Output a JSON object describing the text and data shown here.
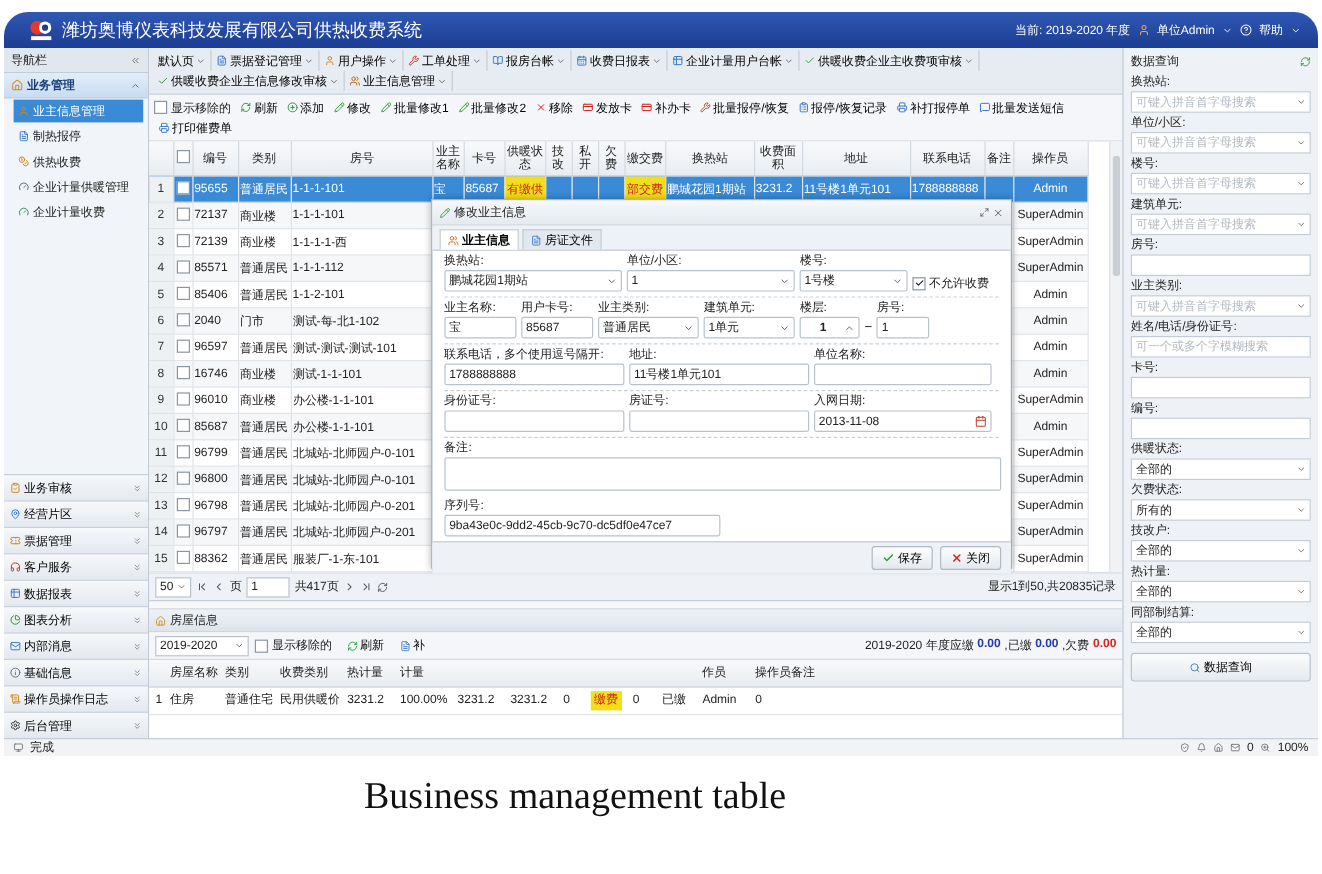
{
  "window": {
    "title": "潍坊奥博仪表科技发展有限公司供热收费系统",
    "year": "当前: 2019-2020 年度",
    "user": "单位Admin",
    "help": "帮助"
  },
  "sidebar": {
    "title": "导航栏",
    "section": "业务管理",
    "items": [
      {
        "label": "业主信息管理",
        "selected": true
      },
      {
        "label": "制热报停",
        "selected": false
      },
      {
        "label": "供热收费",
        "selected": false
      },
      {
        "label": "企业计量供暖管理",
        "selected": false
      },
      {
        "label": "企业计量收费",
        "selected": false
      }
    ],
    "groups": [
      "业务审核",
      "经营片区",
      "票据管理",
      "客户服务",
      "数据报表",
      "图表分析",
      "内部消息",
      "基础信息",
      "操作员操作日志",
      "后台管理"
    ]
  },
  "menu_tabs": [
    "默认页",
    "票据登记管理",
    "用户操作",
    "工单处理",
    "报房台帐",
    "收费日报表",
    "企业计量用户台帐",
    "供暖收费企业主收费项审核",
    "供暖收费企业主信息修改审核",
    "业主信息管理"
  ],
  "show_removed": {
    "label": "显示移除的",
    "checked": false
  },
  "actions": [
    "刷新",
    "添加",
    "修改",
    "批量修改1",
    "批量修改2",
    "移除",
    "发放卡",
    "补办卡",
    "批量报停/恢复",
    "报停/恢复记录",
    "补打报停单",
    "批量发送短信",
    "打印催费单"
  ],
  "table": {
    "header_checked": false,
    "columns": [
      "编号",
      "类别",
      "房号",
      "业主名称",
      "卡号",
      "供暖状态",
      "技改",
      "私开",
      "欠费",
      "缴交费",
      "换热站",
      "收费面积",
      "地址",
      "联系电话",
      "备注",
      "操作员"
    ],
    "rows": [
      {
        "index": "1",
        "selected": true,
        "checked": false,
        "number": "95655",
        "category": "普通居民",
        "room": "1-1-1-101",
        "owner": "宝",
        "card": "85687",
        "heating": "有缴供",
        "payment": "部交费",
        "station": "鹏城花园1期站",
        "area": "3231.2",
        "address": "11号楼1单元101",
        "phone": "1788888888",
        "operator": "Admin"
      },
      {
        "index": "2",
        "selected": false,
        "checked": false,
        "number": "72137",
        "category": "商业楼",
        "room": "1-1-1-101",
        "operator": "SuperAdmin"
      },
      {
        "index": "3",
        "selected": false,
        "checked": false,
        "number": "72139",
        "category": "商业楼",
        "room": "1-1-1-1-西",
        "operator": "SuperAdmin"
      },
      {
        "index": "4",
        "selected": false,
        "checked": false,
        "number": "85571",
        "category": "普通居民",
        "room": "1-1-1-112",
        "operator": "SuperAdmin"
      },
      {
        "index": "5",
        "selected": false,
        "checked": false,
        "number": "85406",
        "category": "普通居民",
        "room": "1-1-2-101",
        "operator": "Admin"
      },
      {
        "index": "6",
        "selected": false,
        "checked": false,
        "number": "2040",
        "category": "门市",
        "room": "测试-每-北1-102",
        "operator": "Admin"
      },
      {
        "index": "7",
        "selected": false,
        "checked": false,
        "number": "96597",
        "category": "普通居民",
        "room": "测试-测试-测试-101",
        "operator": "Admin"
      },
      {
        "index": "8",
        "selected": false,
        "checked": false,
        "number": "16746",
        "category": "商业楼",
        "room": "测试-1-1-101",
        "operator": "Admin"
      },
      {
        "index": "9",
        "selected": false,
        "checked": false,
        "number": "96010",
        "category": "商业楼",
        "room": "办公楼-1-1-101",
        "operator": "SuperAdmin"
      },
      {
        "index": "10",
        "selected": false,
        "checked": false,
        "number": "85687",
        "category": "普通居民",
        "room": "办公楼-1-1-101",
        "operator": "Admin"
      },
      {
        "index": "11",
        "selected": false,
        "checked": false,
        "number": "96799",
        "category": "普通居民",
        "room": "北城站-北师园户-0-101",
        "operator": "SuperAdmin"
      },
      {
        "index": "12",
        "selected": false,
        "checked": false,
        "number": "96800",
        "category": "普通居民",
        "room": "北城站-北师园户-0-101",
        "operator": "SuperAdmin"
      },
      {
        "index": "13",
        "selected": false,
        "checked": false,
        "number": "96798",
        "category": "普通居民",
        "room": "北城站-北师园户-0-201",
        "operator": "SuperAdmin"
      },
      {
        "index": "14",
        "selected": false,
        "checked": false,
        "number": "96797",
        "category": "普通居民",
        "room": "北城站-北师园户-0-201",
        "operator": "SuperAdmin"
      },
      {
        "index": "15",
        "selected": false,
        "checked": false,
        "number": "88362",
        "category": "普通居民",
        "room": "服装厂-1-东-101",
        "operator": "SuperAdmin"
      }
    ]
  },
  "pager": {
    "page_size": "50",
    "page_label": "页",
    "page": "1",
    "total_pages": "共417页",
    "summary": "显示1到50,共20835记录"
  },
  "house_panel": {
    "title": "房屋信息",
    "year": "2019-2020",
    "show_removed": {
      "label": "显示移除的",
      "checked": false
    },
    "refresh": "刷新",
    "more": "补",
    "totals": [
      {
        "label": "2019-2020 年度应缴",
        "value": "0.00",
        "color": "#2236b8"
      },
      {
        "label": ",已缴",
        "value": "0.00",
        "color": "#2236b8"
      },
      {
        "label": ",欠费",
        "value": "0.00",
        "color": "#e02020"
      }
    ],
    "columns": [
      "房屋名称",
      "类别",
      "收费类别",
      "热计量",
      "计量",
      "作员",
      "操作员备注"
    ],
    "row": {
      "index": "1",
      "cells": [
        {
          "text": "住房",
          "highlight": false
        },
        {
          "text": "普通住宅",
          "highlight": false
        },
        {
          "text": "民用供暖价",
          "highlight": false
        },
        {
          "text": "3231.2",
          "highlight": false
        },
        {
          "text": "100.00%",
          "highlight": false
        },
        {
          "text": "3231.2",
          "highlight": false
        },
        {
          "text": "3231.2",
          "highlight": false
        },
        {
          "text": "0",
          "highlight": false
        },
        {
          "text": "缴费",
          "highlight": true
        },
        {
          "text": "0",
          "highlight": false
        },
        {
          "text": "已缴",
          "highlight": false
        },
        {
          "text": "Admin",
          "highlight": false
        },
        {
          "text": "0",
          "highlight": false
        }
      ]
    }
  },
  "dialog": {
    "title": "修改业主信息",
    "tabs": [
      {
        "label": "业主信息",
        "selected": true
      },
      {
        "label": "房证文件",
        "selected": false
      }
    ],
    "groups": [
      {
        "fields": [
          {
            "label": "换热站:",
            "kind": "select",
            "value": "鹏城花园1期站"
          },
          {
            "label": "单位/小区:",
            "kind": "select",
            "value": "1"
          },
          {
            "label": "楼号:",
            "kind": "select",
            "value": "1号楼"
          },
          {
            "label": "不允许收费",
            "kind": "checkbox",
            "checked": true
          }
        ]
      },
      {
        "fields": [
          {
            "label": "业主名称:",
            "kind": "input",
            "value": "宝"
          },
          {
            "label": "用户卡号:",
            "kind": "input",
            "value": "85687"
          },
          {
            "label": "业主类别:",
            "kind": "select",
            "value": "普通居民"
          },
          {
            "label": "建筑单元:",
            "kind": "select",
            "value": "1单元"
          },
          {
            "label": "楼层:",
            "kind": "spinner",
            "value": "1"
          },
          {
            "label": "房号:",
            "kind": "input",
            "value": "1",
            "separator": "−"
          }
        ]
      },
      {
        "fields": [
          {
            "label": "联系电话，多个使用逗号隔开:",
            "kind": "input",
            "value": "1788888888"
          },
          {
            "label": "地址:",
            "kind": "input",
            "value": "11号楼1单元101"
          },
          {
            "label": "单位名称:",
            "kind": "input"
          }
        ]
      },
      {
        "fields": [
          {
            "label": "身份证号:",
            "kind": "input"
          },
          {
            "label": "房证号:",
            "kind": "input"
          },
          {
            "label": "入网日期:",
            "kind": "date",
            "value": "2013-11-08"
          }
        ]
      },
      {
        "fields": [
          {
            "label": "备注:",
            "kind": "textarea"
          }
        ]
      },
      {
        "fields": [
          {
            "label": "序列号:",
            "kind": "input",
            "value": "9ba43e0c-9dd2-45cb-9c70-dc5df0e47ce7"
          }
        ]
      }
    ],
    "buttons": [
      {
        "label": "保存",
        "kind": "save"
      },
      {
        "label": "关闭",
        "kind": "close"
      }
    ]
  },
  "query": {
    "title": "数据查询",
    "fields": [
      {
        "label": "换热站:",
        "kind": "select",
        "placeholder": "可键入拼音首字母搜索"
      },
      {
        "label": "单位/小区:",
        "kind": "select",
        "placeholder": "可键入拼音首字母搜索"
      },
      {
        "label": "楼号:",
        "kind": "select",
        "placeholder": "可键入拼音首字母搜索"
      },
      {
        "label": "建筑单元:",
        "kind": "select",
        "placeholder": "可键入拼音首字母搜索"
      },
      {
        "label": "房号:",
        "kind": "input"
      },
      {
        "label": "业主类别:",
        "kind": "select",
        "placeholder": "可键入拼音首字母搜索"
      },
      {
        "label": "姓名/电话/身份证号:",
        "kind": "input",
        "placeholder": "可一个或多个字模糊搜索"
      },
      {
        "label": "卡号:",
        "kind": "input"
      },
      {
        "label": "编号:",
        "kind": "input"
      },
      {
        "label": "供暖状态:",
        "kind": "select",
        "value": "全部的"
      },
      {
        "label": "欠费状态:",
        "kind": "select",
        "value": "所有的"
      },
      {
        "label": "技改户:",
        "kind": "select",
        "value": "全部的"
      },
      {
        "label": "热计量:",
        "kind": "select",
        "value": "全部的"
      },
      {
        "label": "同部制结算:",
        "kind": "select",
        "value": "全部的"
      }
    ],
    "button": "数据查询"
  },
  "status_bar": {
    "text": "完成",
    "messages": "0",
    "zoom": "100%"
  },
  "caption": "Business management table"
}
